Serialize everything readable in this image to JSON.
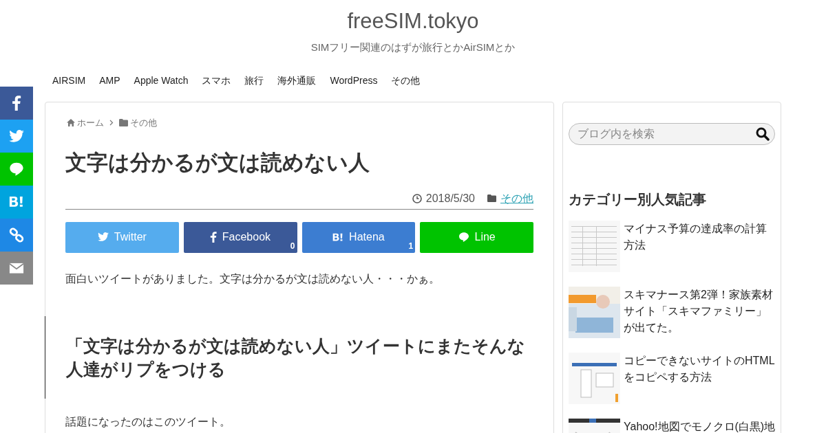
{
  "site": {
    "title": "freeSIM.tokyo",
    "tagline": "SIMフリー関連のはずが旅行とかAirSIMとか"
  },
  "nav": [
    "AIRSIM",
    "AMP",
    "Apple Watch",
    "スマホ",
    "旅行",
    "海外通販",
    "WordPress",
    "その他"
  ],
  "side_share": [
    {
      "kind": "facebook",
      "color": "#3b5998"
    },
    {
      "kind": "twitter",
      "color": "#1da1f2"
    },
    {
      "kind": "line",
      "color": "#00c300"
    },
    {
      "kind": "hatena",
      "color": "#00a4de"
    },
    {
      "kind": "link",
      "color": "#1e88e5"
    },
    {
      "kind": "mail",
      "color": "#888888"
    }
  ],
  "breadcrumb": [
    {
      "kind": "home",
      "label": "ホーム"
    },
    {
      "kind": "folder",
      "label": "その他"
    }
  ],
  "article": {
    "title": "文字は分かるが文は読めない人",
    "date": "2018/5/30",
    "category": "その他",
    "share": [
      {
        "kind": "twitter",
        "label": "Twitter",
        "color": "#55acee"
      },
      {
        "kind": "facebook",
        "label": "Facebook",
        "color": "#3b5998",
        "count": "0"
      },
      {
        "kind": "hatena",
        "label": "Hatena",
        "color": "#3c7dd1",
        "count": "1"
      },
      {
        "kind": "line",
        "label": "Line",
        "color": "#00c300"
      }
    ],
    "intro": "面白いツイートがありました。文字は分かるが文は読めない人・・・かぁ。",
    "heading": "「文字は分かるが文は読めない人」ツイートにまたそんな人達がリプをつける",
    "para": "話題になったのはこのツイート。"
  },
  "sidebar": {
    "search": {
      "placeholder": "ブログ内を検索"
    },
    "popular_title": "カテゴリー別人気記事",
    "posts": [
      {
        "title": "マイナス予算の達成率の計算方法",
        "kind": "picture"
      },
      {
        "title": "スキマナース第2弾！家族素材サイト「スキマファミリー」が出てた。",
        "kind": "picture"
      },
      {
        "title": "コピーできないサイトのHTMLをコピペする方法",
        "kind": "picture"
      },
      {
        "title": "Yahoo!地図でモノクロ(白黒)地",
        "kind": "picture"
      }
    ]
  }
}
